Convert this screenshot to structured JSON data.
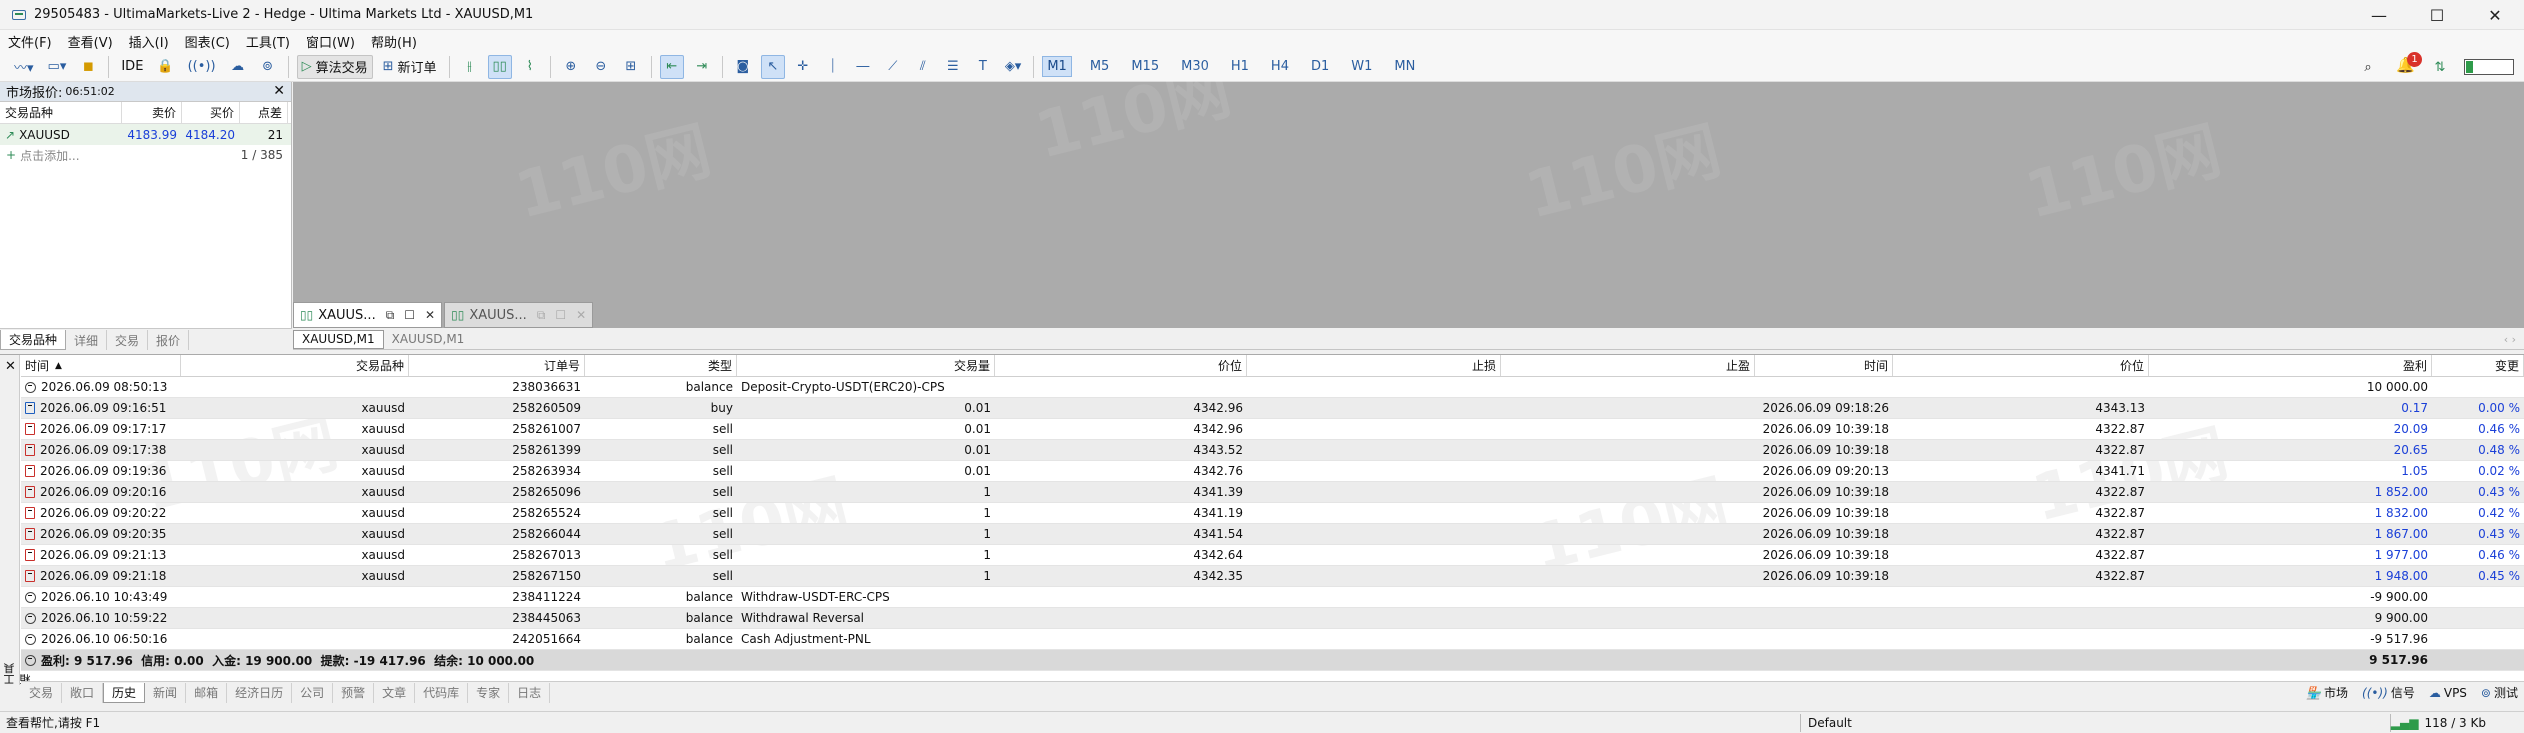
{
  "window": {
    "title": "29505483 - UltimaMarkets-Live 2 - Hedge - Ultima Markets Ltd - XAUUSD,M1",
    "minimize": "—",
    "maximize": "☐",
    "close": "✕"
  },
  "menu": [
    "文件(F)",
    "查看(V)",
    "插入(I)",
    "图表(C)",
    "工具(T)",
    "窗口(W)",
    "帮助(H)"
  ],
  "toolbar": {
    "ide": "IDE",
    "algo_trading": "算法交易",
    "new_order": "新订单",
    "timeframes": [
      "M1",
      "M5",
      "M15",
      "M30",
      "H1",
      "H4",
      "D1",
      "W1",
      "MN"
    ],
    "active_timeframe": "M1",
    "notification_count": "1",
    "signal_level": 0.15
  },
  "market_watch": {
    "title": "市场报价:",
    "time": "06:51:02",
    "close": "✕",
    "columns": [
      "交易品种",
      "卖价",
      "买价",
      "点差"
    ],
    "rows": [
      {
        "symbol": "XAUUSD",
        "bid": "4183.99",
        "ask": "4184.20",
        "spread": "21"
      }
    ],
    "add_placeholder": "点击添加...",
    "count": "1 / 385",
    "tabs": [
      "交易品种",
      "详细",
      "交易",
      "报价"
    ],
    "active_tab": "交易品种"
  },
  "watermark": "110网",
  "chart_windows": [
    {
      "label": "XAUUS...",
      "active": true
    },
    {
      "label": "XAUUS...",
      "active": false
    }
  ],
  "chart_tabs": [
    "XAUUSD,M1",
    "XAUUSD,M1"
  ],
  "history": {
    "columns": [
      "时间",
      "交易品种",
      "订单号",
      "类型",
      "交易量",
      "价位",
      "止损",
      "止盈",
      "时间",
      "价位",
      "盈利",
      "变更"
    ],
    "rows": [
      {
        "kind": "balance",
        "time": "2026.06.09 08:50:13",
        "symbol": "",
        "ticket": "238036631",
        "type": "balance",
        "volume": "Deposit-Crypto-USDT(ERC20)-CPS",
        "price": "",
        "sl": "",
        "tp": "",
        "close_time": "",
        "close_price": "",
        "profit": "10 000.00",
        "change": ""
      },
      {
        "kind": "buy",
        "time": "2026.06.09 09:16:51",
        "symbol": "xauusd",
        "ticket": "258260509",
        "type": "buy",
        "volume": "0.01",
        "price": "4342.96",
        "sl": "",
        "tp": "",
        "close_time": "2026.06.09 09:18:26",
        "close_price": "4343.13",
        "profit": "0.17",
        "change": "0.00 %"
      },
      {
        "kind": "sell",
        "time": "2026.06.09 09:17:17",
        "symbol": "xauusd",
        "ticket": "258261007",
        "type": "sell",
        "volume": "0.01",
        "price": "4342.96",
        "sl": "",
        "tp": "",
        "close_time": "2026.06.09 10:39:18",
        "close_price": "4322.87",
        "profit": "20.09",
        "change": "0.46 %"
      },
      {
        "kind": "sell",
        "time": "2026.06.09 09:17:38",
        "symbol": "xauusd",
        "ticket": "258261399",
        "type": "sell",
        "volume": "0.01",
        "price": "4343.52",
        "sl": "",
        "tp": "",
        "close_time": "2026.06.09 10:39:18",
        "close_price": "4322.87",
        "profit": "20.65",
        "change": "0.48 %"
      },
      {
        "kind": "sell",
        "time": "2026.06.09 09:19:36",
        "symbol": "xauusd",
        "ticket": "258263934",
        "type": "sell",
        "volume": "0.01",
        "price": "4342.76",
        "sl": "",
        "tp": "",
        "close_time": "2026.06.09 09:20:13",
        "close_price": "4341.71",
        "profit": "1.05",
        "change": "0.02 %"
      },
      {
        "kind": "sell",
        "time": "2026.06.09 09:20:16",
        "symbol": "xauusd",
        "ticket": "258265096",
        "type": "sell",
        "volume": "1",
        "price": "4341.39",
        "sl": "",
        "tp": "",
        "close_time": "2026.06.09 10:39:18",
        "close_price": "4322.87",
        "profit": "1 852.00",
        "change": "0.43 %"
      },
      {
        "kind": "sell",
        "time": "2026.06.09 09:20:22",
        "symbol": "xauusd",
        "ticket": "258265524",
        "type": "sell",
        "volume": "1",
        "price": "4341.19",
        "sl": "",
        "tp": "",
        "close_time": "2026.06.09 10:39:18",
        "close_price": "4322.87",
        "profit": "1 832.00",
        "change": "0.42 %"
      },
      {
        "kind": "sell",
        "time": "2026.06.09 09:20:35",
        "symbol": "xauusd",
        "ticket": "258266044",
        "type": "sell",
        "volume": "1",
        "price": "4341.54",
        "sl": "",
        "tp": "",
        "close_time": "2026.06.09 10:39:18",
        "close_price": "4322.87",
        "profit": "1 867.00",
        "change": "0.43 %"
      },
      {
        "kind": "sell",
        "time": "2026.06.09 09:21:13",
        "symbol": "xauusd",
        "ticket": "258267013",
        "type": "sell",
        "volume": "1",
        "price": "4342.64",
        "sl": "",
        "tp": "",
        "close_time": "2026.06.09 10:39:18",
        "close_price": "4322.87",
        "profit": "1 977.00",
        "change": "0.46 %"
      },
      {
        "kind": "sell",
        "time": "2026.06.09 09:21:18",
        "symbol": "xauusd",
        "ticket": "258267150",
        "type": "sell",
        "volume": "1",
        "price": "4342.35",
        "sl": "",
        "tp": "",
        "close_time": "2026.06.09 10:39:18",
        "close_price": "4322.87",
        "profit": "1 948.00",
        "change": "0.45 %"
      },
      {
        "kind": "balance",
        "time": "2026.06.10 10:43:49",
        "symbol": "",
        "ticket": "238411224",
        "type": "balance",
        "volume": "Withdraw-USDT-ERC-CPS",
        "price": "",
        "sl": "",
        "tp": "",
        "close_time": "",
        "close_price": "",
        "profit": "-9 900.00",
        "change": ""
      },
      {
        "kind": "balance",
        "time": "2026.06.10 10:59:22",
        "symbol": "",
        "ticket": "238445063",
        "type": "balance",
        "volume": "Withdrawal Reversal",
        "price": "",
        "sl": "",
        "tp": "",
        "close_time": "",
        "close_price": "",
        "profit": "9 900.00",
        "change": ""
      },
      {
        "kind": "balance",
        "time": "2026.06.10 06:50:16",
        "symbol": "",
        "ticket": "242051664",
        "type": "balance",
        "volume": "Cash Adjustment-PNL",
        "price": "",
        "sl": "",
        "tp": "",
        "close_time": "",
        "close_price": "",
        "profit": "-9 517.96",
        "change": ""
      }
    ],
    "summary": "盈利: 9 517.96  信用: 0.00  入金: 19 900.00  提款: -19 417.96  结余: 10 000.00",
    "summary_profit": "9 517.96"
  },
  "toolbox": {
    "close": "✕",
    "label": "工具箱",
    "tabs": [
      "交易",
      "敞口",
      "历史",
      "新闻",
      "邮箱",
      "经济日历",
      "公司",
      "预警",
      "文章",
      "代码库",
      "专家",
      "日志"
    ],
    "active_tab": "历史",
    "right_items": [
      "市场",
      "信号",
      "VPS",
      "测试"
    ]
  },
  "statusbar": {
    "help": "查看帮忙,请按 F1",
    "profile": "Default",
    "traffic": "118 / 3 Kb"
  }
}
